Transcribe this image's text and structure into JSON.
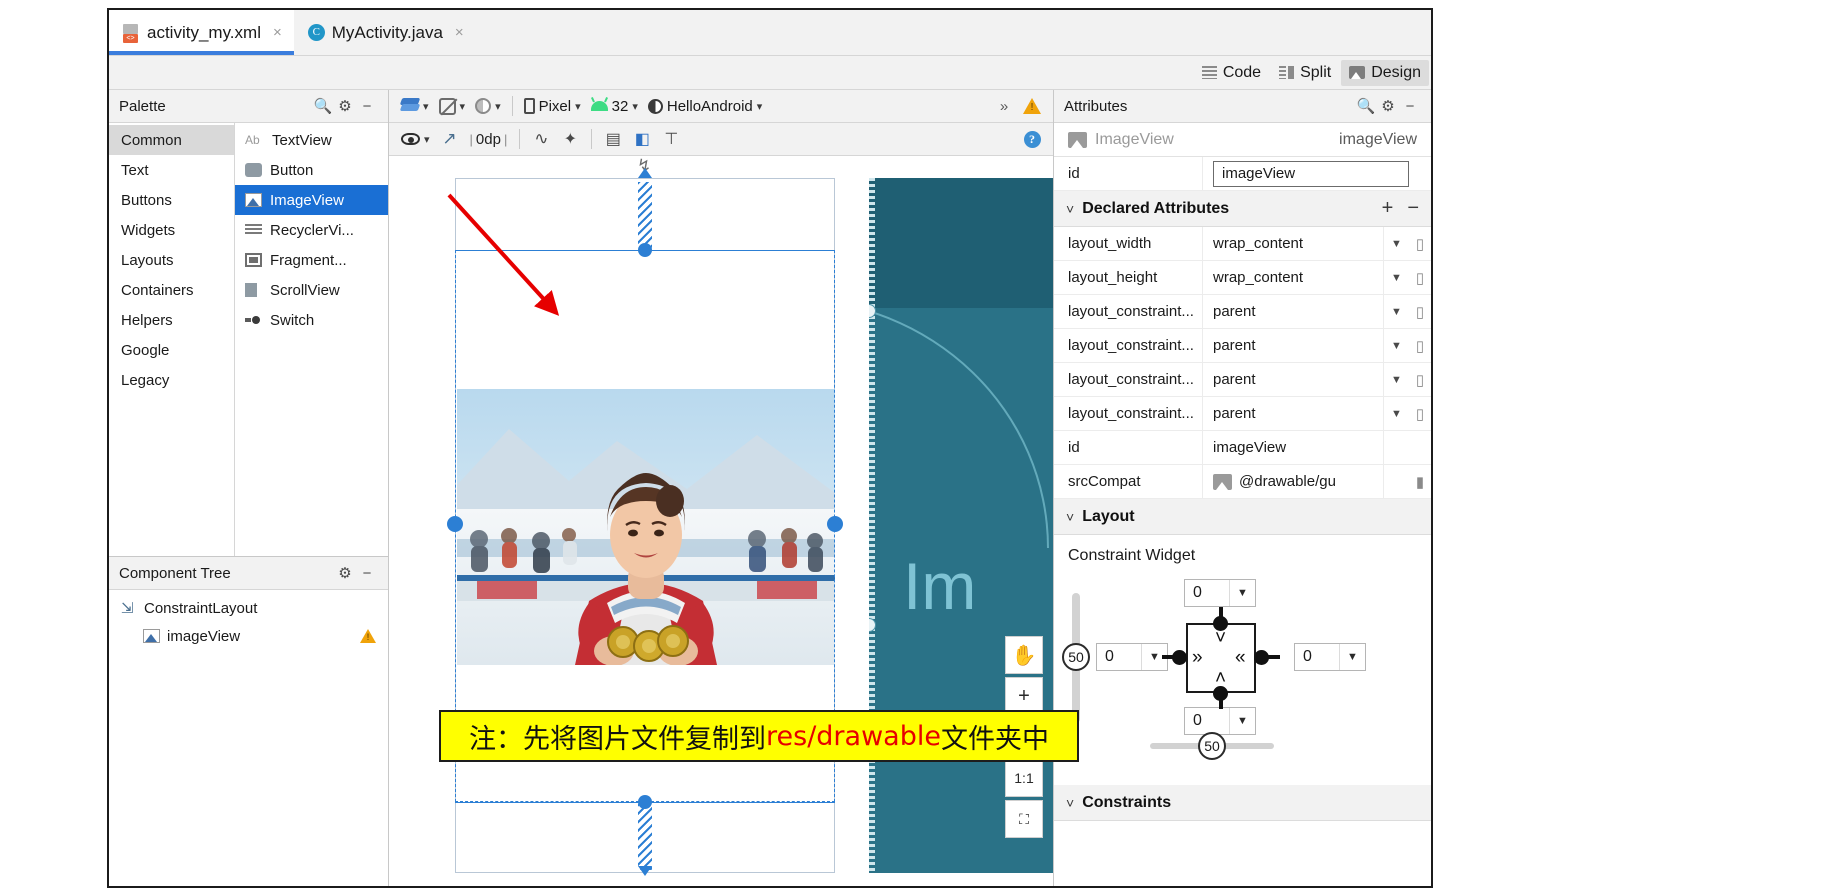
{
  "tabs": [
    {
      "label": "activity_my.xml",
      "icon": "xml-file-icon",
      "active": true,
      "close": "×"
    },
    {
      "label": "MyActivity.java",
      "icon": "java-class-icon",
      "active": false,
      "close": "×"
    }
  ],
  "modebar": {
    "code": "Code",
    "split": "Split",
    "design": "Design"
  },
  "palette": {
    "title": "Palette",
    "search_icon": "🔍",
    "gear_icon": "⚙",
    "minimize_icon": "−",
    "categories": [
      {
        "label": "Common",
        "selected": true
      },
      {
        "label": "Text",
        "selected": false
      },
      {
        "label": "Buttons",
        "selected": false
      },
      {
        "label": "Widgets",
        "selected": false
      },
      {
        "label": "Layouts",
        "selected": false
      },
      {
        "label": "Containers",
        "selected": false
      },
      {
        "label": "Helpers",
        "selected": false
      },
      {
        "label": "Google",
        "selected": false
      },
      {
        "label": "Legacy",
        "selected": false
      }
    ],
    "items": [
      {
        "label": "TextView",
        "icon": "textview-icon",
        "selected": false
      },
      {
        "label": "Button",
        "icon": "button-icon",
        "selected": false
      },
      {
        "label": "ImageView",
        "icon": "imageview-icon",
        "selected": true
      },
      {
        "label": "RecyclerVi...",
        "icon": "recyclerview-icon",
        "selected": false
      },
      {
        "label": "Fragment...",
        "icon": "fragment-icon",
        "selected": false
      },
      {
        "label": "ScrollView",
        "icon": "scrollview-icon",
        "selected": false
      },
      {
        "label": "Switch",
        "icon": "switch-icon",
        "selected": false
      }
    ]
  },
  "component_tree": {
    "title": "Component Tree",
    "gear_icon": "⚙",
    "minimize_icon": "−",
    "nodes": [
      {
        "label": "ConstraintLayout",
        "icon": "constraintlayout-icon",
        "depth": 0,
        "warning": false
      },
      {
        "label": "imageView",
        "icon": "imageview-icon",
        "depth": 1,
        "warning": true
      }
    ]
  },
  "design_toolbar": {
    "design_surface_icon": "layers-icon",
    "orientation_icon": "rotate-icon",
    "theme_icon": "theme-icon",
    "device": "Pixel",
    "api_level": "32",
    "theme": "HelloAndroid",
    "overflow": "»",
    "warning_icon": "warning-triangle-icon",
    "row2": {
      "eye_icon": "eye-visibility-icon",
      "magnet_icon": "autoconnect-off-icon",
      "default_margin": "0dp",
      "clear_constraints_icon": "clear-constraints-icon",
      "infer_constraints_icon": "infer-constraints-icon",
      "guidelines_icon": "guidelines-icon",
      "align_icon": "align-icon",
      "baseline_icon": "baseline-icon",
      "help_icon": "?"
    }
  },
  "canvas": {
    "blueprint_label": "Im",
    "zoom_controls": [
      {
        "label": "✋",
        "name": "pan-tool-button"
      },
      {
        "label": "+",
        "name": "zoom-in-button"
      },
      {
        "label": "−",
        "name": "zoom-out-button"
      },
      {
        "label": "1:1",
        "name": "zoom-actual-size-button"
      },
      {
        "label": "⛶",
        "name": "zoom-to-fit-button"
      }
    ]
  },
  "annotation": {
    "prefix": "注：先将图片文件复制到",
    "highlight": "res/drawable",
    "suffix": "文件夹中",
    "highlight_color": "#e60000",
    "background_color": "#ffff00"
  },
  "attributes": {
    "title": "Attributes",
    "search_icon": "🔍",
    "gear_icon": "⚙",
    "minimize_icon": "−",
    "widget_type": "ImageView",
    "widget_id": "imageView",
    "id_row": {
      "key": "id",
      "value": "imageView"
    },
    "declared": {
      "title": "Declared Attributes",
      "add_icon": "+",
      "remove_icon": "−",
      "rows": [
        {
          "key": "layout_width",
          "value": "wrap_content",
          "dropdown": true,
          "bar": true
        },
        {
          "key": "layout_height",
          "value": "wrap_content",
          "dropdown": true,
          "bar": true
        },
        {
          "key": "layout_constraint...",
          "value": "parent",
          "dropdown": true,
          "bar": true
        },
        {
          "key": "layout_constraint...",
          "value": "parent",
          "dropdown": true,
          "bar": true
        },
        {
          "key": "layout_constraint...",
          "value": "parent",
          "dropdown": true,
          "bar": true
        },
        {
          "key": "layout_constraint...",
          "value": "parent",
          "dropdown": true,
          "bar": true
        },
        {
          "key": "id",
          "value": "imageView",
          "dropdown": false,
          "bar": false
        },
        {
          "key": "srcCompat",
          "value": "@drawable/gu",
          "dropdown": false,
          "bar": true,
          "icon": "image-resource-icon"
        }
      ]
    },
    "layout": {
      "title": "Layout",
      "constraint_widget_label": "Constraint Widget",
      "margin_top": "0",
      "margin_left": "0",
      "margin_right": "0",
      "margin_bottom": "0",
      "vertical_bias": "50",
      "horizontal_bias": "50",
      "arrow_right_glyph": "»",
      "arrow_left_glyph": "«",
      "arrow_down_glyph": "˅",
      "arrow_up_glyph": "˄",
      "dropdown_glyph": "▼"
    },
    "constraints": {
      "title": "Constraints"
    }
  }
}
